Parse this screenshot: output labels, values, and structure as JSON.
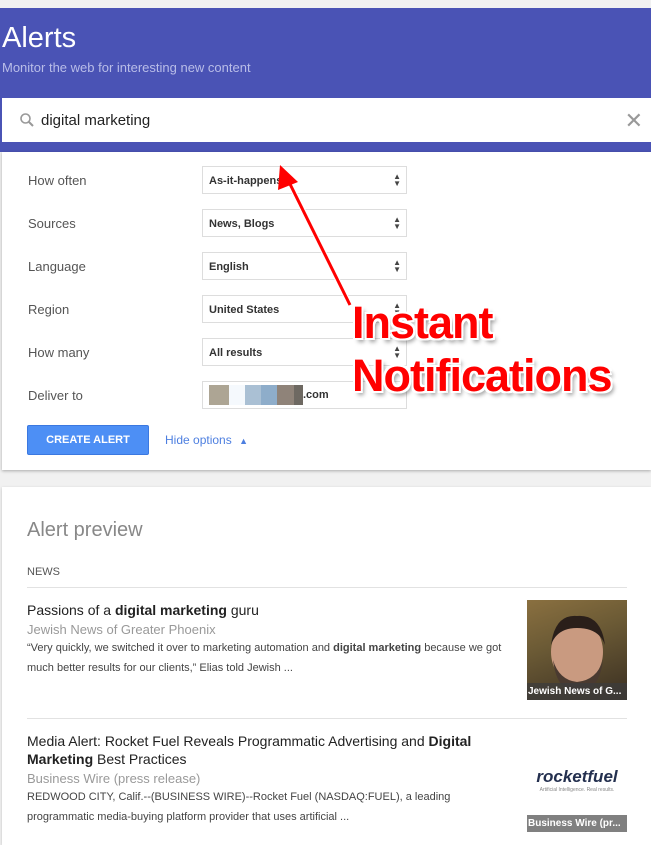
{
  "header": {
    "title": "Alerts",
    "subtitle": "Monitor the web for interesting new content"
  },
  "search": {
    "value": "digital marketing",
    "icon": "search-icon",
    "clear_icon": "close-icon"
  },
  "options": [
    {
      "label": "How often",
      "value": "As-it-happens"
    },
    {
      "label": "Sources",
      "value": "News, Blogs"
    },
    {
      "label": "Language",
      "value": "English"
    },
    {
      "label": "Region",
      "value": "United States"
    },
    {
      "label": "How many",
      "value": "All results"
    },
    {
      "label": "Deliver to",
      "value": ".com"
    }
  ],
  "create_button": "CREATE ALERT",
  "hide_options": "Hide options",
  "preview": {
    "heading": "Alert preview",
    "section": "NEWS",
    "items": [
      {
        "title_pre": "Passions of a ",
        "title_bold": "digital marketing",
        "title_post": " guru",
        "source": "Jewish News of Greater Phoenix",
        "snippet_pre": "“Very quickly, we switched it over to marketing automation and ",
        "snippet_bold": "digital marketing",
        "snippet_post": " because we got much better results for our clients,” Elias told Jewish ...",
        "thumb_caption": "Jewish News of G..."
      },
      {
        "title_pre": "Media Alert: Rocket Fuel Reveals Programmatic Advertising and ",
        "title_bold": "Digital Marketing",
        "title_post": " Best Practices",
        "source": "Business Wire (press release)",
        "snippet_pre": "REDWOOD CITY, Calif.--(BUSINESS WIRE)--Rocket Fuel (NASDAQ:FUEL), a leading programmatic media-buying platform provider that uses artificial ...",
        "snippet_bold": "",
        "snippet_post": "",
        "thumb_caption": "Business Wire (pr...",
        "logo_text": "rocketfuel",
        "logo_tagline": "Artificial Intelligence. Real results."
      }
    ]
  },
  "annotation": {
    "line1": "Instant",
    "line2": "Notifications",
    "color": "#ff0000"
  },
  "colors": {
    "header": "#4a53b5",
    "button": "#4d8ff5"
  }
}
